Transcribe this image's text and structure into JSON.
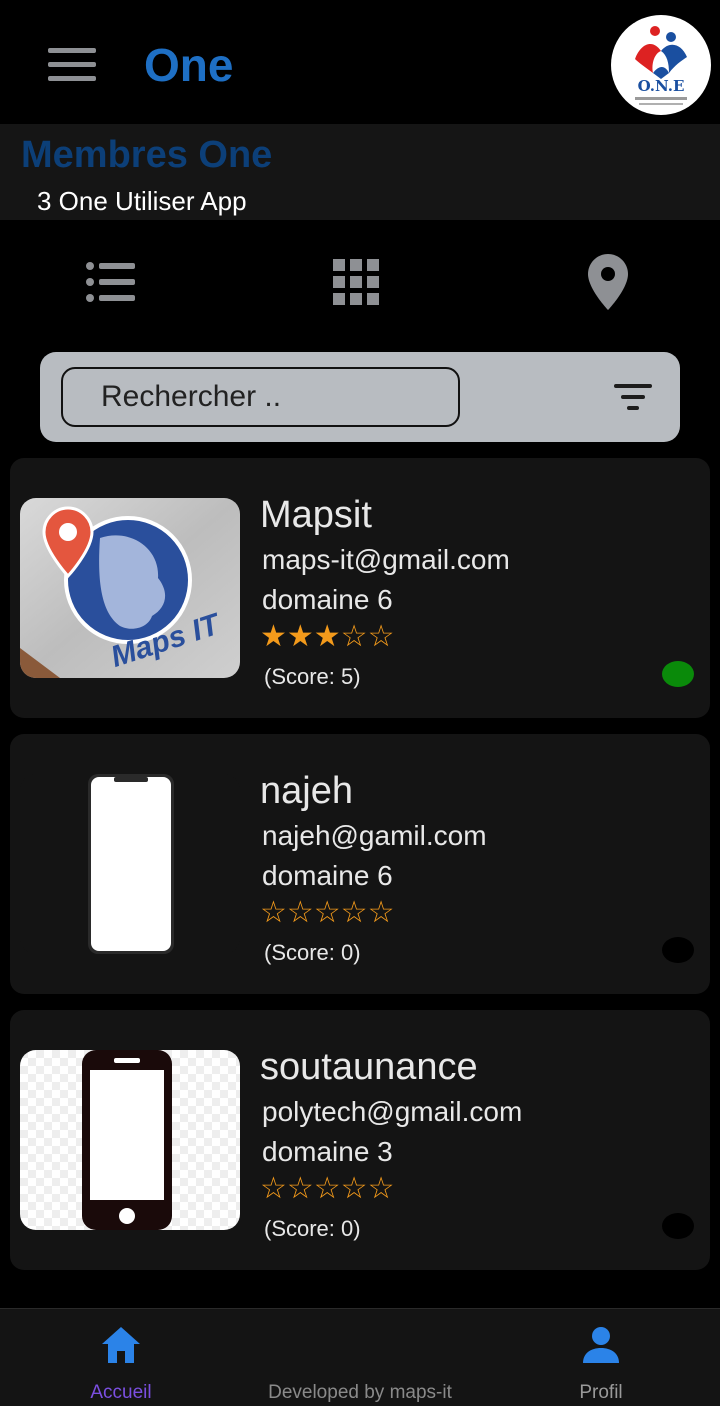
{
  "appbar": {
    "title": "One",
    "menu_icon": "hamburger-menu-icon",
    "logo_text": "O.N.E"
  },
  "header": {
    "title": "Membres One",
    "subtitle": "3 One Utiliser App"
  },
  "view_toggles": [
    {
      "name": "list-view-icon"
    },
    {
      "name": "grid-view-icon"
    },
    {
      "name": "map-pin-icon"
    }
  ],
  "search": {
    "placeholder": "Rechercher ..",
    "filter_icon": "filter-icon"
  },
  "members": [
    {
      "name": "Mapsit",
      "email": "maps-it@gmail.com",
      "domain": "domaine 6",
      "rating": 3,
      "stars": "★★★☆☆",
      "score": "(Score: 5)",
      "status_color": "#0a8a0a",
      "logo_text": "Maps IT"
    },
    {
      "name": "najeh",
      "email": "najeh@gamil.com",
      "domain": "domaine 6",
      "rating": 0,
      "stars": "☆☆☆☆☆",
      "score": "(Score: 0)",
      "status_color": "#000000"
    },
    {
      "name": "soutaunance",
      "email": "polytech@gmail.com",
      "domain": "domaine 3",
      "rating": 0,
      "stars": "☆☆☆☆☆",
      "score": "(Score: 0)",
      "status_color": "#000000"
    }
  ],
  "bottom_nav": {
    "home_label": "Accueil",
    "credit": "Developed by maps-it",
    "profile_label": "Profil"
  },
  "colors": {
    "accent": "#1e6fc4",
    "active_label": "#7b4fe0",
    "star": "#f39a1b",
    "nav_icon": "#2b83e8"
  }
}
